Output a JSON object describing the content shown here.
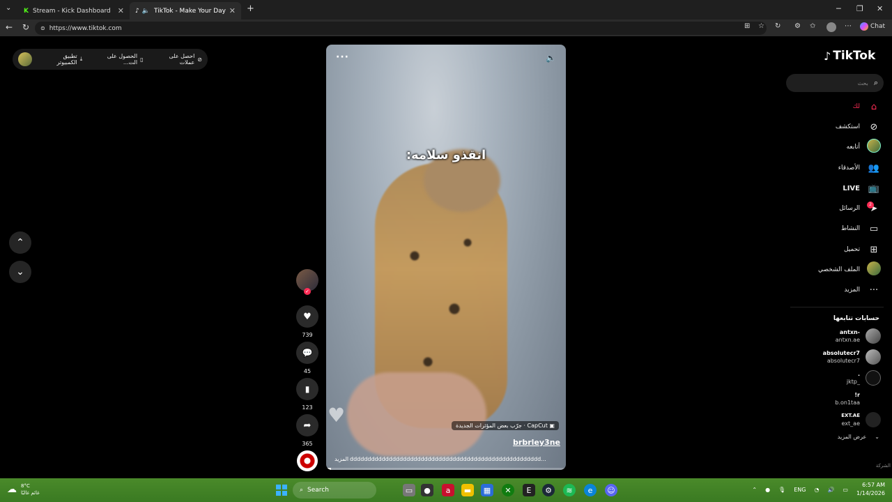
{
  "browser": {
    "tabs": [
      {
        "title": "Stream - Kick Dashboard",
        "active": false,
        "icon": "kick-icon"
      },
      {
        "title": "TikTok - Make Your Day",
        "active": true,
        "icon": "tiktok-icon"
      }
    ],
    "new_tab": "+",
    "url": "https://www.tiktok.com",
    "chat_label": "Chat"
  },
  "topbar": {
    "get_coins": "احصل على عملات",
    "get_app": "الحصول على الت...",
    "desktop_app": "تطبيق الكمبيوتر"
  },
  "video": {
    "caption": "انقذو سلامه:",
    "effect": "CapCut · جرّب بعض المؤثرات الجديدة",
    "username": "brbrley3ne",
    "description": "dddddddddddddddddddddddddddddddddddddddddddddddddddddd...",
    "more": "المزيد",
    "progress": 0.02
  },
  "actions": {
    "likes": "739",
    "comments": "45",
    "saves": "123",
    "shares": "365"
  },
  "sidebar": {
    "logo": "TikTok",
    "search_placeholder": "بحث",
    "nav": [
      {
        "label": "لك",
        "icon": "home-icon"
      },
      {
        "label": "استكشف",
        "icon": "compass-icon"
      },
      {
        "label": "أتابعه",
        "icon": "avatar-icon"
      },
      {
        "label": "الأصدقاء",
        "icon": "friends-icon"
      },
      {
        "label": "LIVE",
        "icon": "live-tv-icon"
      },
      {
        "label": "الرسائل",
        "icon": "messages-icon",
        "badge": "2"
      },
      {
        "label": "النشاط",
        "icon": "activity-icon"
      },
      {
        "label": "تحميل",
        "icon": "upload-icon"
      },
      {
        "label": "الملف الشخصي",
        "icon": "profile-icon"
      },
      {
        "label": "المزيد",
        "icon": "more-icon"
      }
    ],
    "following_title": "حسابات تتابعها",
    "following": [
      {
        "name": "antxn-",
        "handle": "antxn.ae"
      },
      {
        "name": "absolutecr7",
        "handle": "absolutecr7"
      },
      {
        "name": ".",
        "handle": "jktp_"
      },
      {
        "name": "!r",
        "handle": "b.on1taa"
      },
      {
        "name": "EXT.AE",
        "handle": "ext_ae"
      }
    ],
    "see_more": "عرض المزيد",
    "company": "الشركة"
  },
  "taskbar": {
    "temp": "8°C",
    "weather": "غائم غالبًا",
    "search": "Search",
    "lang": "ENG",
    "time": "6:57 AM",
    "date": "1/14/2026"
  },
  "colors": {
    "accent": "#fe2c55",
    "taskbar": "#3f7f25"
  }
}
